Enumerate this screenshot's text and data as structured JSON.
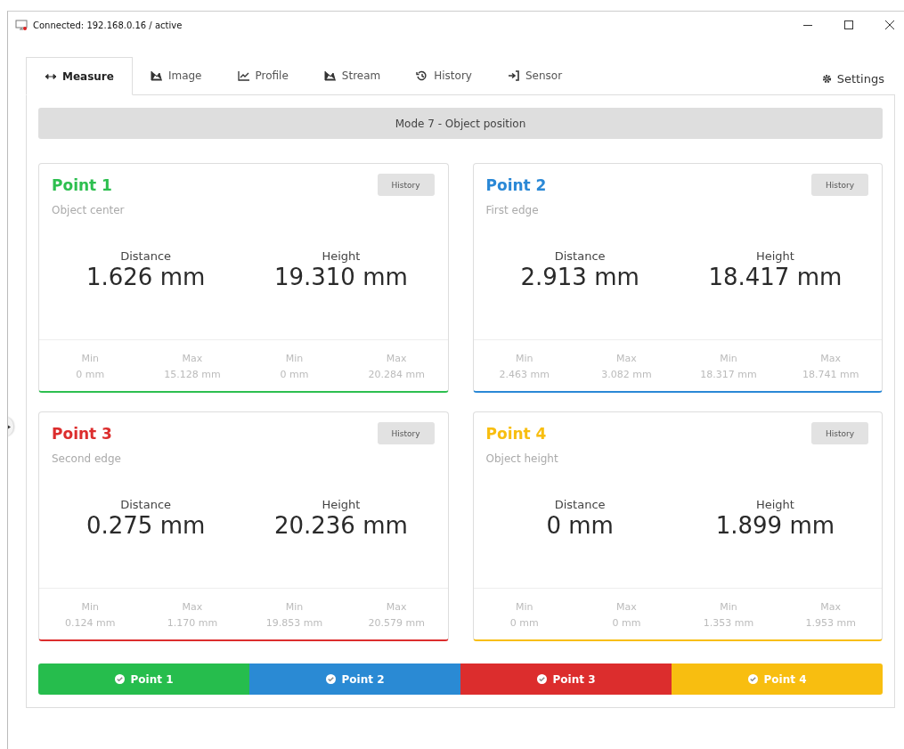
{
  "window": {
    "title": "Connected: 192.168.0.16 / active"
  },
  "tabs": [
    {
      "label": "Measure",
      "selected": true
    },
    {
      "label": "Image",
      "selected": false
    },
    {
      "label": "Profile",
      "selected": false
    },
    {
      "label": "Stream",
      "selected": false
    },
    {
      "label": "History",
      "selected": false
    },
    {
      "label": "Sensor",
      "selected": false
    }
  ],
  "settings": {
    "label": "Settings"
  },
  "mode_bar": {
    "label": "Mode 7 - Object position"
  },
  "points": [
    {
      "title": "Point 1",
      "color": "#2dbf4f",
      "subtitle": "Object center",
      "button": "History",
      "distance": {
        "label": "Distance",
        "value": "1.626 mm"
      },
      "height": {
        "label": "Height",
        "value": "19.310 mm"
      },
      "stats": [
        {
          "label": "Min",
          "value": "0 mm"
        },
        {
          "label": "Max",
          "value": "15.128 mm"
        },
        {
          "label": "Min",
          "value": "0 mm"
        },
        {
          "label": "Max",
          "value": "20.284 mm"
        }
      ]
    },
    {
      "title": "Point 2",
      "color": "#2a88d6",
      "subtitle": "First edge",
      "button": "History",
      "distance": {
        "label": "Distance",
        "value": "2.913 mm"
      },
      "height": {
        "label": "Height",
        "value": "18.417 mm"
      },
      "stats": [
        {
          "label": "Min",
          "value": "2.463 mm"
        },
        {
          "label": "Max",
          "value": "3.082 mm"
        },
        {
          "label": "Min",
          "value": "18.317 mm"
        },
        {
          "label": "Max",
          "value": "18.741 mm"
        }
      ]
    },
    {
      "title": "Point 3",
      "color": "#dc2d2d",
      "subtitle": "Second edge",
      "button": "History",
      "distance": {
        "label": "Distance",
        "value": "0.275 mm"
      },
      "height": {
        "label": "Height",
        "value": "20.236 mm"
      },
      "stats": [
        {
          "label": "Min",
          "value": "0.124 mm"
        },
        {
          "label": "Max",
          "value": "1.170 mm"
        },
        {
          "label": "Min",
          "value": "19.853 mm"
        },
        {
          "label": "Max",
          "value": "20.579 mm"
        }
      ]
    },
    {
      "title": "Point 4",
      "color": "#f8be10",
      "subtitle": "Object height",
      "button": "History",
      "distance": {
        "label": "Distance",
        "value": "0 mm"
      },
      "height": {
        "label": "Height",
        "value": "1.899 mm"
      },
      "stats": [
        {
          "label": "Min",
          "value": "0 mm"
        },
        {
          "label": "Max",
          "value": "0 mm"
        },
        {
          "label": "Min",
          "value": "1.353 mm"
        },
        {
          "label": "Max",
          "value": "1.953 mm"
        }
      ]
    }
  ],
  "toggles": [
    {
      "label": "Point 1",
      "color": "#26bd4d",
      "on": true
    },
    {
      "label": "Point 2",
      "color": "#2a8ad4",
      "on": true
    },
    {
      "label": "Point 3",
      "color": "#dc2d2d",
      "on": true
    },
    {
      "label": "Point 4",
      "color": "#f8be10",
      "on": true
    }
  ]
}
